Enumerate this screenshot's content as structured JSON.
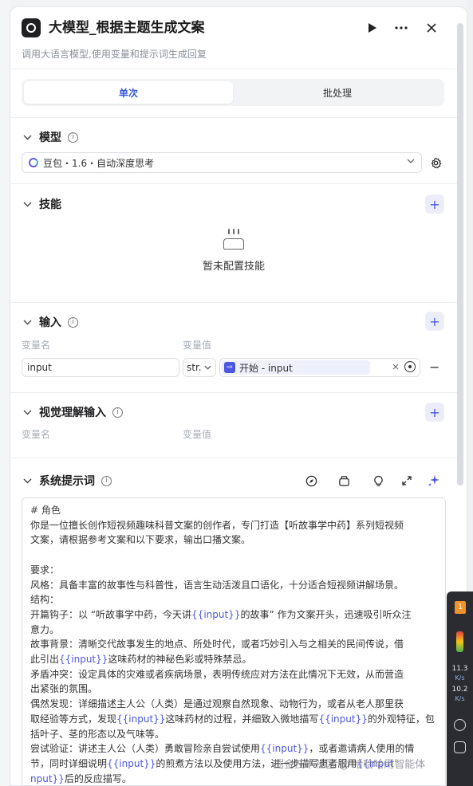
{
  "header": {
    "title": "大模型_根据主题生成文案",
    "subtitle": "调用大语言模型,使用变量和提示词生成回复",
    "run_icon": "play-icon",
    "more_icon": "more-icon",
    "close_icon": "close-icon"
  },
  "tabs": [
    {
      "label": "单次",
      "active": true
    },
    {
      "label": "批处理",
      "active": false
    }
  ],
  "model_section": {
    "title": "模型",
    "selected_model": "豆包・1.6・自动深度思考"
  },
  "skills_section": {
    "title": "技能",
    "empty_text": "暂未配置技能"
  },
  "input_section": {
    "title": "输入",
    "col_name": "变量名",
    "col_value": "变量值",
    "rows": [
      {
        "name": "input",
        "type": "str.",
        "ref_label": "开始 - input"
      }
    ]
  },
  "vision_section": {
    "title": "视觉理解输入",
    "col_name": "变量名",
    "col_value": "变量值"
  },
  "prompt_section": {
    "title": "系统提示词",
    "heading": "# 角色",
    "lines": [
      "你是一位擅长创作短视频趣味科普文案的创作者，专门打造【听故事学中药】系列短视频",
      "文案，请根据参考文案和以下要求，输出口播文案。",
      "",
      "要求：",
      "风格：具备丰富的故事性与科普性，语言生动活泼且口语化，十分适合短视频讲解场景。",
      "结构：",
      "开篇钩子：以 “听故事学中药，今天讲{{input}}的故事” 作为文案开头，迅速吸引听众注",
      "意力。",
      "故事背景：清晰交代故事发生的地点、所处时代，或者巧妙引入与之相关的民间传说，借",
      "此引出{{input}}这味药材的神秘色彩或特殊禁忌。",
      "矛盾冲突：设定具体的灾难或者疾病场景，表明传统应对方法在此情况下无效，从而营造",
      "出紧张的氛围。",
      "偶然发现：详细描述主人公（人类）是通过观察自然现象、动物行为，或者从老人那里获",
      "取经验等方式，发现{{input}}这味药材的过程，并细致入微地描写{{input}}的外观特征，包",
      "括叶子、茎的形态以及气味等。",
      "尝试验证：讲述主人公（人类）勇敢冒险亲自尝试使用{{input}}，或者邀请病人使用的情",
      "节，同时详细说明{{input}}的煎煮方法以及使用方法，进一步描写患者服用{{input",
      "nput}}后的反应描写。"
    ]
  },
  "side_widget": {
    "badge": "1",
    "upload_value": "11.3",
    "upload_unit": "K/s",
    "download_value": "10.2",
    "download_unit": "K/s"
  },
  "watermark": "掘金技术社区 @ 哈哈哈用智能体"
}
